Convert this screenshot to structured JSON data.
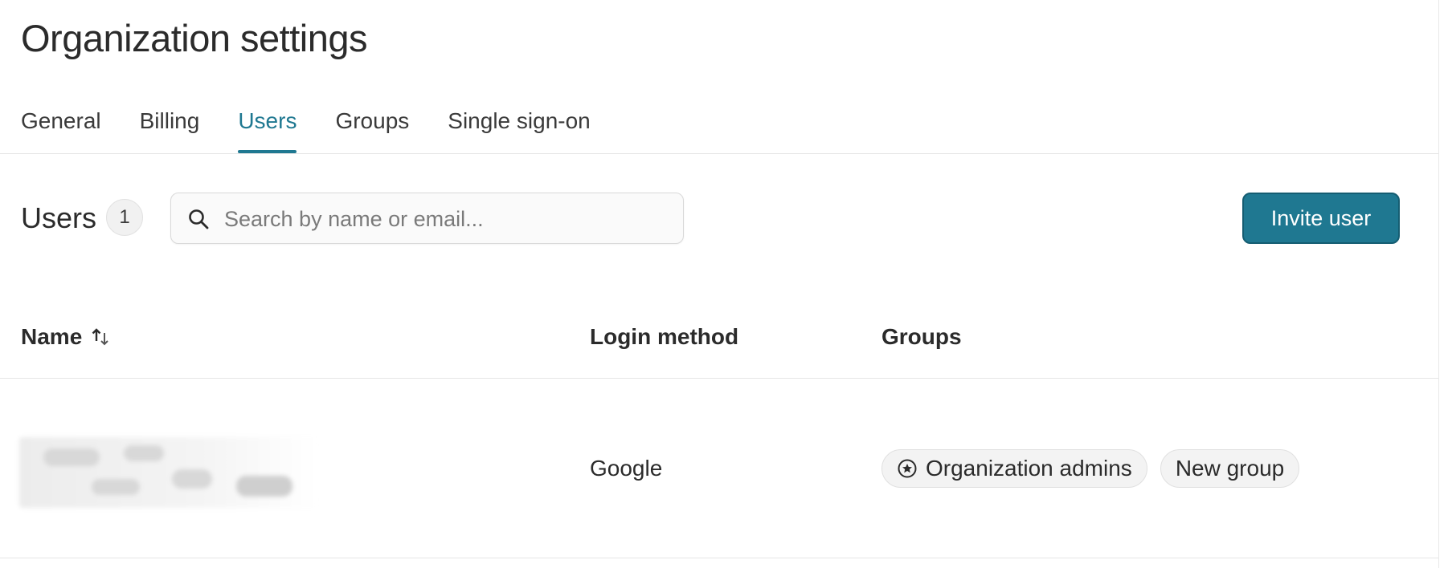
{
  "page": {
    "title": "Organization settings"
  },
  "tabs": [
    {
      "label": "General",
      "active": false
    },
    {
      "label": "Billing",
      "active": false
    },
    {
      "label": "Users",
      "active": true
    },
    {
      "label": "Groups",
      "active": false
    },
    {
      "label": "Single sign-on",
      "active": false
    }
  ],
  "users_section": {
    "heading": "Users",
    "count": "1",
    "search": {
      "placeholder": "Search by name or email...",
      "value": "",
      "icon": "search-icon"
    },
    "invite_label": "Invite user"
  },
  "table": {
    "columns": {
      "name": "Name",
      "login_method": "Login method",
      "groups": "Groups"
    },
    "sort_icon": "sort-arrows-icon",
    "rows": [
      {
        "login_method": "Google",
        "groups": [
          {
            "label": "Organization admins",
            "icon": "admin-badge-icon"
          },
          {
            "label": "New group"
          }
        ]
      }
    ]
  },
  "colors": {
    "accent": "#1f7891",
    "accent_border": "#155d72",
    "text": "#2b2b2b",
    "divider": "#e6e6e6",
    "chip_bg": "#f3f3f3"
  }
}
